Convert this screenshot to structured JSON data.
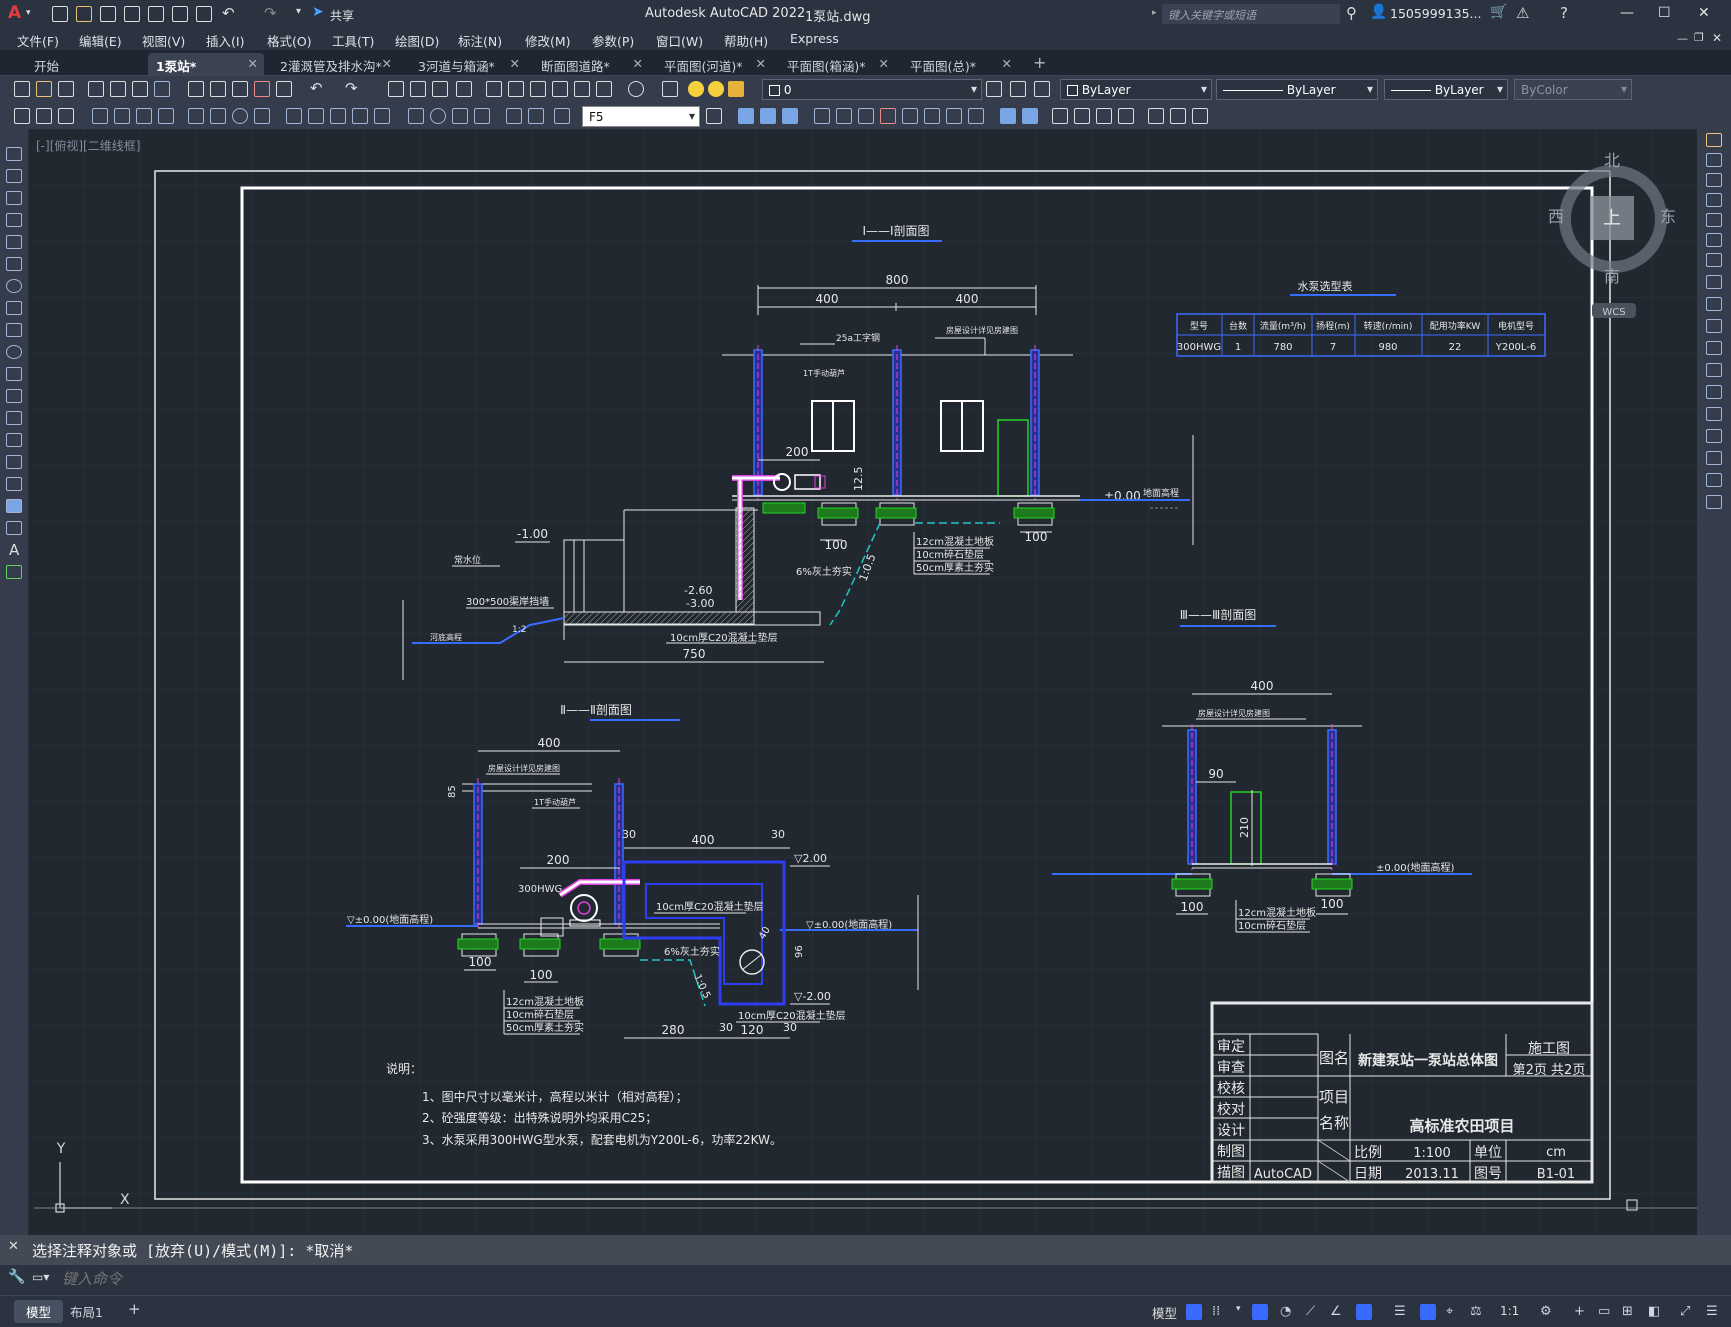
{
  "app": {
    "title": "Autodesk AutoCAD 2022",
    "file": "1泵站.dwg",
    "share": "共享",
    "search_placeholder": "键入关键字或短语",
    "user": "1505999135...",
    "logo": "A"
  },
  "menu": [
    "文件(F)",
    "编辑(E)",
    "视图(V)",
    "插入(I)",
    "格式(O)",
    "工具(T)",
    "绘图(D)",
    "标注(N)",
    "修改(M)",
    "参数(P)",
    "窗口(W)",
    "帮助(H)",
    "Express"
  ],
  "tabs": [
    {
      "label": "开始",
      "active": false,
      "closable": false
    },
    {
      "label": "1泵站*",
      "active": true,
      "closable": true
    },
    {
      "label": "2灌溉管及排水沟*",
      "active": false,
      "closable": true
    },
    {
      "label": "3河道与箱涵*",
      "active": false,
      "closable": true
    },
    {
      "label": "断面图道路*",
      "active": false,
      "closable": true
    },
    {
      "label": "平面图(河道)*",
      "active": false,
      "closable": true
    },
    {
      "label": "平面图(箱涵)*",
      "active": false,
      "closable": true
    },
    {
      "label": "平面图(总)*",
      "active": false,
      "closable": true
    }
  ],
  "toolbar": {
    "layer_value": "0",
    "color": "ByLayer",
    "linetype": "ByLayer",
    "lineweight": "ByLayer",
    "plotstyle": "ByColor",
    "dimstyle": "F5"
  },
  "viewport": {
    "label": "[-][俯视][二维线框]"
  },
  "viewcube": {
    "north": "北",
    "south": "南",
    "east": "东",
    "west": "西",
    "top": "上",
    "wcs": "WCS"
  },
  "ucs": {
    "x": "X",
    "y": "Y"
  },
  "drawing": {
    "section1_title": "Ⅰ——Ⅰ剖面图",
    "section2_title": "Ⅱ——Ⅱ剖面图",
    "section3_title": "Ⅲ——Ⅲ剖面图",
    "pump_table_title": "水泵选型表",
    "pump_table_headers": [
      "型号",
      "台数",
      "流量(m³/h)",
      "扬程(m)",
      "转速(r/min)",
      "配用功率KW",
      "电机型号"
    ],
    "pump_table_row": [
      "300HWG",
      "1",
      "780",
      "7",
      "980",
      "22",
      "Y200L-6"
    ],
    "s1": {
      "dim_800": "800",
      "dim_400a": "400",
      "dim_400b": "400",
      "i_beam": "25a工字钢",
      "house_note": "房屋设计详见房建图",
      "hoist": "1T手动葫芦",
      "dim_200": "200",
      "dim_125": "12.5",
      "elev_000": "±0.00",
      "ground": "地面高程",
      "elev_m100": "-1.00",
      "water": "常水位",
      "wall": "300*500渠岸挡墙",
      "river": "河底高程",
      "elev_m260": "-2.60",
      "elev_m300": "-3.00",
      "slope": "1:2",
      "bottom": "10cm厚C20混凝土垫层",
      "dim_750": "750",
      "dim_100a": "100",
      "dim_100b": "100",
      "backfill": "6%灰土夯实",
      "slope2": "1:0.5",
      "layer1": "12cm混凝土地板",
      "layer2": "10cm碎石垫层",
      "layer3": "50cm厚素土夯实"
    },
    "s2": {
      "dim_400": "400",
      "house_note": "房屋设计详见房建图",
      "hoist": "1T手动葫芦",
      "dim_30a": "30",
      "dim_400b": "400",
      "dim_30b": "30",
      "dim_200": "200",
      "pump": "300HWG",
      "elev_200": "▽2.00",
      "elev_000l": "▽±0.00(地面高程)",
      "elev_000r": "▽±0.00(地面高程)",
      "pad": "10cm厚C20混凝土垫层",
      "dim_40": "40",
      "dim_96": "96",
      "backfill": "6%灰土夯实",
      "slope": "1:0.5",
      "elev_m200": "▽-2.00",
      "dim_100a": "100",
      "dim_100b": "100",
      "layer1": "12cm混凝土地板",
      "layer2": "10cm碎石垫层",
      "layer3": "50cm厚素土夯实",
      "bottom": "10cm厚C20混凝土垫层",
      "dim_280": "280",
      "dim_30c": "30",
      "dim_120": "120",
      "dim_30d": "30",
      "dim_85": "85"
    },
    "s3": {
      "dim_400": "400",
      "house_note": "房屋设计详见房建图",
      "dim_90": "90",
      "dim_210": "210",
      "elev": "±0.00(地面高程)",
      "dim_100a": "100",
      "dim_100b": "100",
      "layer1": "12cm混凝土地板",
      "layer2": "10cm碎石垫层"
    },
    "notes_title": "说明：",
    "notes": [
      "1、图中尺寸以毫米计，高程以米计（相对高程）；",
      "2、砼强度等级：出特殊说明外均采用C25；",
      "3、水泵采用300HWG型水泵，配套电机为Y200L-6，功率22KW。"
    ],
    "titleblock": {
      "r1": "审定",
      "r2": "审查",
      "r3": "校核",
      "r4": "校对",
      "r5": "设计",
      "r6": "制图",
      "r7": "描图",
      "tuming": "图名",
      "name": "新建泵站一泵站总体图",
      "stage": "施工图",
      "page": "第2页 共2页",
      "xiangmu": "项目",
      "mingcheng": "名称",
      "project": "高标准农田项目",
      "scale_l": "比例",
      "scale": "1:100",
      "unit_l": "单位",
      "unit": "cm",
      "date_l": "日期",
      "date": "2013.11",
      "no_l": "图号",
      "no": "B1-01",
      "autocad": "AutoCAD"
    }
  },
  "command": {
    "history": "选择注释对象或 [放弃(U)/模式(M)]: *取消*",
    "placeholder": "键入命令"
  },
  "status": {
    "model_tab": "模型",
    "layout_tab": "布局1",
    "add": "+",
    "model_btn": "模型",
    "scale": "1:1"
  }
}
